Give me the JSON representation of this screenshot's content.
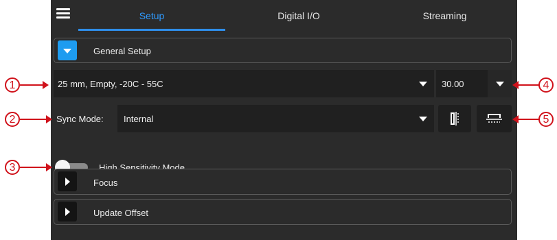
{
  "tabs": [
    {
      "label": "Setup",
      "active": true
    },
    {
      "label": "Digital I/O",
      "active": false
    },
    {
      "label": "Streaming",
      "active": false
    }
  ],
  "general_setup": {
    "title": "General Setup",
    "expanded": true
  },
  "lens_select": {
    "value": "25 mm, Empty, -20C - 55C"
  },
  "fps_select": {
    "value": "30.00"
  },
  "sync_mode": {
    "label": "Sync Mode:",
    "value": "Internal"
  },
  "high_sensitivity": {
    "label": "High Sensitivity Mode",
    "enabled": false
  },
  "sections": [
    {
      "title": "Focus",
      "expanded": false
    },
    {
      "title": "Update Offset",
      "expanded": false
    }
  ],
  "callouts": [
    "1",
    "2",
    "3",
    "4",
    "5"
  ],
  "icons": {
    "menu": "hamburger-menu-icon",
    "expand": "chevron-down-icon",
    "collapse": "chevron-right-icon",
    "dropdown": "caret-down-icon",
    "flip_horizontal": "flip-horizontal-icon",
    "flip_vertical": "flip-vertical-icon"
  },
  "colors": {
    "accent": "#2f9bff",
    "active_expander": "#1e9cf0",
    "callout": "#d0121b",
    "panel_bg": "#2b2b2b"
  }
}
